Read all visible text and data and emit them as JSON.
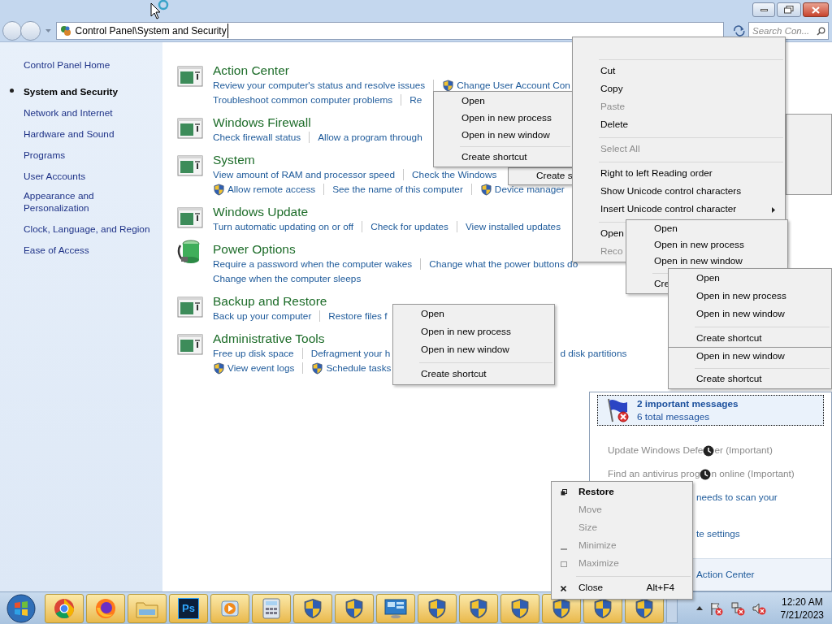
{
  "window": {
    "address": "Control Panel\\System and Security",
    "search_placeholder": "Search Con..."
  },
  "sidebar": {
    "home": "Control Panel Home",
    "items": [
      {
        "label": "System and Security",
        "selected": true
      },
      {
        "label": "Network and Internet",
        "selected": false
      },
      {
        "label": "Hardware and Sound",
        "selected": false
      },
      {
        "label": "Programs",
        "selected": false
      },
      {
        "label": "User Accounts",
        "selected": false
      },
      {
        "label": "Appearance and\nPersonalization",
        "selected": false
      },
      {
        "label": "Clock, Language, and Region",
        "selected": false
      },
      {
        "label": "Ease of Access",
        "selected": false
      }
    ]
  },
  "categories": [
    {
      "title": "Action Center",
      "kind": "panel",
      "lines": [
        [
          {
            "text": "Review your computer's status and resolve issues",
            "shield": false
          },
          {
            "text": "Change User Account Con",
            "shield": true
          }
        ],
        [
          {
            "text": "Troubleshoot common computer problems",
            "shield": false
          },
          {
            "text": "Re",
            "shield": false
          }
        ]
      ]
    },
    {
      "title": "Windows Firewall",
      "kind": "panel",
      "lines": [
        [
          {
            "text": "Check firewall status",
            "shield": false
          },
          {
            "text": "Allow a program through",
            "shield": false
          }
        ]
      ]
    },
    {
      "title": "System",
      "kind": "panel",
      "lines": [
        [
          {
            "text": "View amount of RAM and processor speed",
            "shield": false
          },
          {
            "text": "Check the Windows",
            "shield": false
          }
        ],
        [
          {
            "text": "Allow remote access",
            "shield": true
          },
          {
            "text": "See the name of this computer",
            "shield": false
          },
          {
            "text": "Device manager",
            "shield": true
          }
        ]
      ]
    },
    {
      "title": "Windows Update",
      "kind": "panel",
      "lines": [
        [
          {
            "text": "Turn automatic updating on or off",
            "shield": false
          },
          {
            "text": "Check for updates",
            "shield": false
          },
          {
            "text": "View installed updates",
            "shield": false
          }
        ]
      ]
    },
    {
      "title": "Power Options",
      "kind": "power",
      "lines": [
        [
          {
            "text": "Require a password when the computer wakes",
            "shield": false
          },
          {
            "text": "Change what the power buttons do",
            "shield": false
          }
        ],
        [
          {
            "text": "Change when the computer sleeps",
            "shield": false
          }
        ]
      ]
    },
    {
      "title": "Backup and Restore",
      "kind": "panel",
      "lines": [
        [
          {
            "text": "Back up your computer",
            "shield": false
          },
          {
            "text": "Restore files f",
            "shield": false
          }
        ]
      ]
    },
    {
      "title": "Administrative Tools",
      "kind": "panel",
      "lines": [
        [
          {
            "text": "Free up disk space",
            "shield": false
          },
          {
            "text": "Defragment your h",
            "shield": false
          },
          {
            "text": "d disk partitions",
            "shield": false
          }
        ],
        [
          {
            "text": "View event logs",
            "shield": true
          },
          {
            "text": "Schedule tasks",
            "shield": true
          }
        ]
      ]
    }
  ],
  "context_menus": [
    {
      "items": [
        {
          "kind": "item",
          "label": "Create s",
          "disabled": false
        }
      ]
    },
    {
      "items": [
        {
          "kind": "item",
          "label": "Open",
          "disabled": false
        },
        {
          "kind": "item",
          "label": "Open in new process",
          "disabled": false
        },
        {
          "kind": "item",
          "label": "Open in new window",
          "disabled": false
        },
        {
          "kind": "separator"
        },
        {
          "kind": "item",
          "label": "Create shortcut",
          "disabled": false
        }
      ]
    },
    {
      "items": [
        {
          "kind": "separator"
        },
        {
          "kind": "item",
          "label": "Cut",
          "disabled": false
        },
        {
          "kind": "item",
          "label": "Copy",
          "disabled": false
        },
        {
          "kind": "item",
          "label": "Paste",
          "disabled": true
        },
        {
          "kind": "item",
          "label": "Delete",
          "disabled": false
        },
        {
          "kind": "separator"
        },
        {
          "kind": "item",
          "label": "Select All",
          "disabled": true
        },
        {
          "kind": "separator"
        },
        {
          "kind": "item",
          "label": "Right to left Reading order",
          "disabled": false
        },
        {
          "kind": "item",
          "label": "Show Unicode control characters",
          "disabled": false
        },
        {
          "kind": "item",
          "label": "Insert Unicode control character",
          "disabled": false,
          "submenu": true
        },
        {
          "kind": "separator"
        },
        {
          "kind": "item",
          "label": "Open",
          "disabled": false
        },
        {
          "kind": "item",
          "label": "Reco",
          "disabled": true
        }
      ]
    },
    {
      "items": [
        {
          "kind": "item",
          "label": "Open",
          "disabled": false
        },
        {
          "kind": "item",
          "label": "Open in new process",
          "disabled": false
        },
        {
          "kind": "item",
          "label": "Open in new window",
          "disabled": false
        },
        {
          "kind": "separator"
        },
        {
          "kind": "item",
          "label": "Cre",
          "disabled": false
        }
      ]
    },
    {
      "items": [
        {
          "kind": "item",
          "label": "Open",
          "disabled": false
        },
        {
          "kind": "item",
          "label": "Open in new process",
          "disabled": false
        },
        {
          "kind": "item",
          "label": "Open in new window",
          "disabled": false
        },
        {
          "kind": "separator"
        },
        {
          "kind": "item",
          "label": "Create shortcut",
          "disabled": false
        }
      ]
    },
    {
      "items": [
        {
          "kind": "item",
          "label": "Open in new window",
          "disabled": false
        },
        {
          "kind": "separator"
        },
        {
          "kind": "item",
          "label": "Create shortcut",
          "disabled": false
        }
      ]
    },
    {
      "items": [
        {
          "kind": "item",
          "label": "Open",
          "disabled": false
        },
        {
          "kind": "item",
          "label": "Open in new process",
          "disabled": false
        },
        {
          "kind": "item",
          "label": "Open in new window",
          "disabled": false
        },
        {
          "kind": "separator"
        },
        {
          "kind": "item",
          "label": "Create shortcut",
          "disabled": false
        }
      ]
    }
  ],
  "action_center_flyout": {
    "headline": "2 important messages",
    "subline": "6 total messages",
    "messages": [
      {
        "parts": [
          "Update Windows Defe",
          "er (Important)"
        ]
      },
      {
        "parts": [
          "Find an antivirus prog",
          "n online (Important)"
        ]
      },
      {
        "parts": [
          "needs to scan your"
        ]
      },
      {
        "parts": [
          "te settings"
        ]
      }
    ],
    "footer": "Action Center"
  },
  "system_menu": {
    "items": [
      {
        "kind": "item",
        "label": "Restore",
        "default": true,
        "disabled": false
      },
      {
        "kind": "item",
        "label": "Move",
        "default": false,
        "disabled": true
      },
      {
        "kind": "item",
        "label": "Size",
        "default": false,
        "disabled": true
      },
      {
        "kind": "item",
        "label": "Minimize",
        "default": false,
        "disabled": true
      },
      {
        "kind": "item",
        "label": "Maximize",
        "default": false,
        "disabled": true
      },
      {
        "kind": "separator"
      },
      {
        "kind": "item",
        "label": "Close",
        "shortcut": "Alt+F4",
        "default": false,
        "disabled": false
      }
    ]
  },
  "taskbar": {
    "buttons": [
      {
        "kind": "chrome"
      },
      {
        "kind": "firefox"
      },
      {
        "kind": "explorer"
      },
      {
        "kind": "text",
        "label": "Ps"
      },
      {
        "kind": "media"
      },
      {
        "kind": "calculator"
      },
      {
        "kind": "shield"
      },
      {
        "kind": "shield"
      },
      {
        "kind": "remote"
      },
      {
        "kind": "shield"
      },
      {
        "kind": "shield"
      },
      {
        "kind": "shield"
      },
      {
        "kind": "shield"
      },
      {
        "kind": "shield"
      },
      {
        "kind": "shield"
      }
    ],
    "time": "12:20 AM",
    "date": "7/21/2023"
  }
}
